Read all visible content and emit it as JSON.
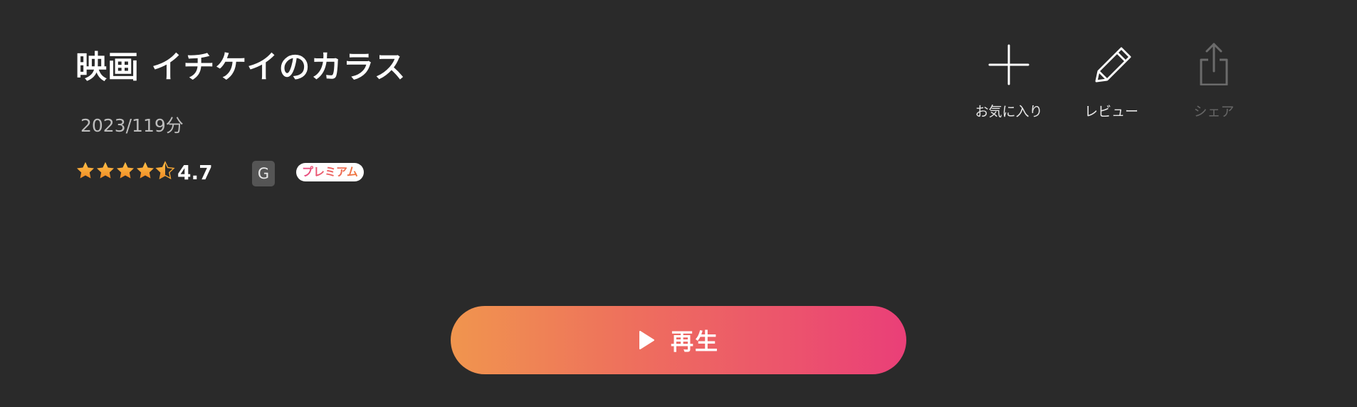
{
  "movie": {
    "title": "映画 イチケイのカラス",
    "meta": "2023/119分",
    "rating": {
      "value": "4.7",
      "stars_filled": 4.5,
      "stars_max": 5
    },
    "age_rating": "G",
    "premium_badge": "プレミアム"
  },
  "actions": {
    "favorite": {
      "label": "お気に入り",
      "icon": "plus-icon"
    },
    "review": {
      "label": "レビュー",
      "icon": "pencil-icon"
    },
    "share": {
      "label": "シェア",
      "icon": "share-icon",
      "enabled": false
    }
  },
  "play": {
    "label": "再生",
    "icon": "play-icon"
  },
  "colors": {
    "background": "#2a2a2a",
    "star": "#f4a534",
    "play_gradient_start": "#f0954e",
    "play_gradient_end": "#ea3f78",
    "disabled": "#666666"
  }
}
